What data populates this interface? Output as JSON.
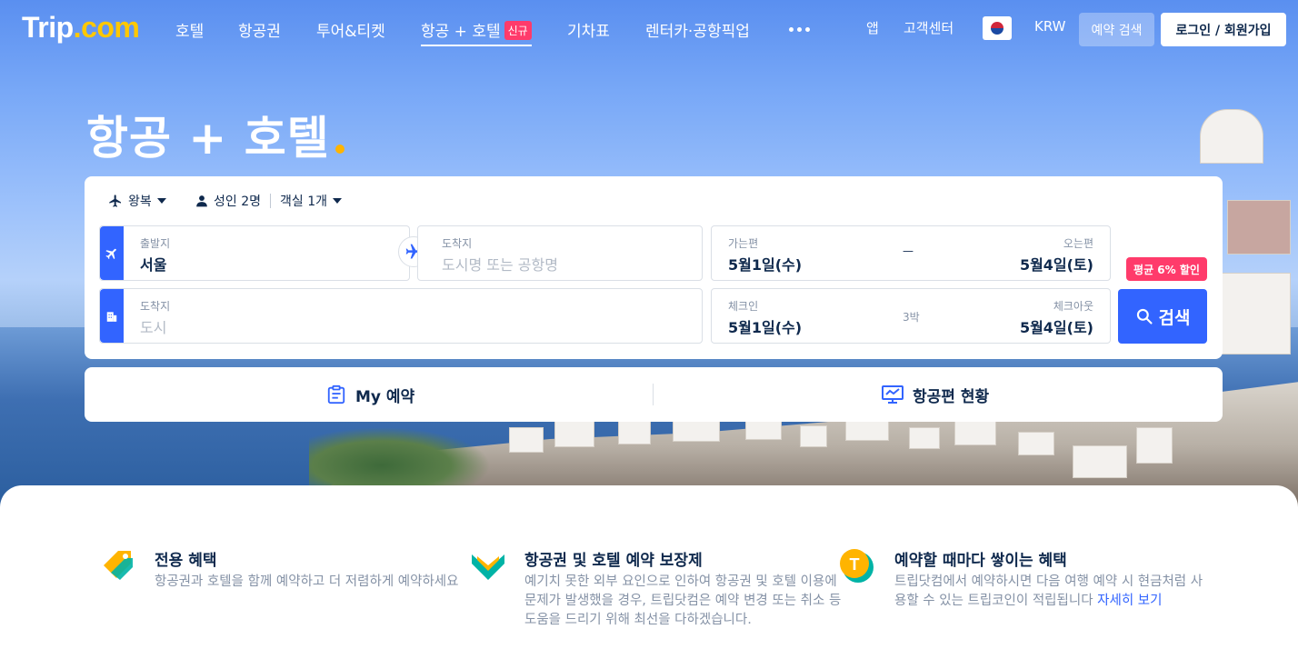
{
  "brand": {
    "name": "Trip",
    "suffix": ".com"
  },
  "nav": {
    "items": [
      "호텔",
      "항공권",
      "투어&티켓",
      "항공 + 호텔",
      "기차표",
      "렌터카·공항픽업"
    ],
    "new_badge": "신규",
    "right": {
      "app": "앱",
      "support": "고객센터",
      "currency": "KRW",
      "reservations": "예약 검색",
      "login": "로그인 / 회원가입"
    }
  },
  "hero": {
    "title": "항공 + 호텔"
  },
  "search": {
    "trip_type": "왕복",
    "passengers": "성인 2명",
    "rooms": "객실 1개",
    "flight_from": {
      "label": "출발지",
      "value": "서울"
    },
    "flight_to": {
      "label": "도착지",
      "placeholder": "도시명 또는 공항명"
    },
    "depart": {
      "label": "가는편",
      "value": "5월1일(수)"
    },
    "return": {
      "label": "오는편",
      "value": "5월4일(토)"
    },
    "date_dash": "—",
    "hotel_dest": {
      "label": "도착지",
      "placeholder": "도시"
    },
    "checkin": {
      "label": "체크인",
      "value": "5월1일(수)"
    },
    "nights": "3박",
    "checkout": {
      "label": "체크아웃",
      "value": "5월4일(토)"
    },
    "discount": "평균 6% 할인",
    "search_button": "검색"
  },
  "quick_links": {
    "my_bookings": "My 예약",
    "flight_status": "항공편 현황"
  },
  "benefits": [
    {
      "title": "전용 혜택",
      "desc": "항공권과 호텔을 함께 예약하고 더 저렴하게 예약하세요"
    },
    {
      "title": "항공권 및 호텔 예약 보장제",
      "desc": "예기치 못한 외부 요인으로 인하여 항공권 및 호텔 이용에 문제가 발생했을 경우, 트립닷컴은 예약 변경 또는 취소 등 도움을 드리기 위해 최선을 다하겠습니다."
    },
    {
      "title": "예약할 때마다 쌓이는 혜택",
      "desc": "트립닷컴에서 예약하시면 다음 여행 예약 시 현금처럼 사용할 수 있는 트립코인이 적립됩니다",
      "link": "자세히 보기"
    }
  ],
  "colors": {
    "primary": "#3264ff",
    "navy": "#0f294d",
    "accent": "#ff3b6b",
    "yellow": "#ffb400"
  }
}
